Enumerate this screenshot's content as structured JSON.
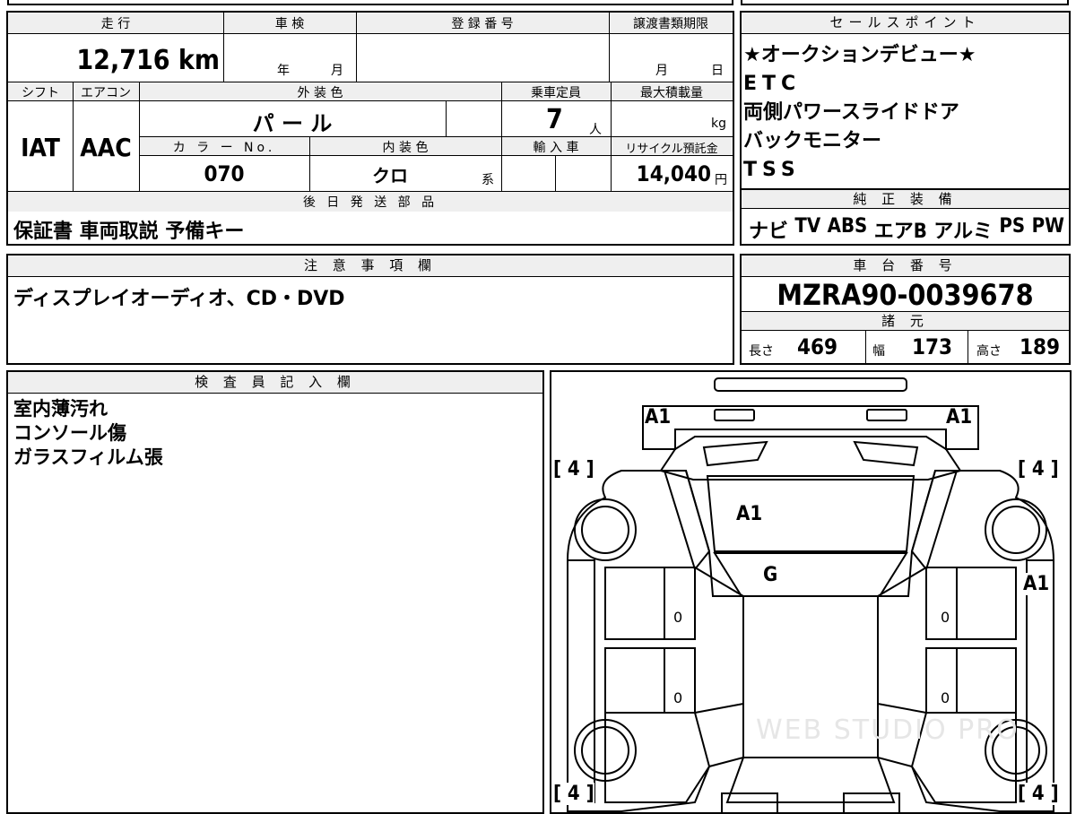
{
  "vehicle": {
    "mileage_label": "走 行",
    "mileage": "12,716 km",
    "inspection_label": "車 検",
    "inspection_year": "年",
    "inspection_month": "月",
    "registration_label": "登 録 番 号",
    "transfer_label": "譲渡書類期限",
    "transfer_month": "月",
    "transfer_day": "日",
    "shift_label": "シフト",
    "shift": "IAT",
    "ac_label": "エアコン",
    "ac": "AAC",
    "exterior_label": "外 装 色",
    "exterior": "パ ー ル",
    "capacity_label": "乗車定員",
    "capacity": "7",
    "capacity_unit": "人",
    "payload_label": "最大積載量",
    "payload_unit": "kg",
    "color_no_label": "カ ラ ー No.",
    "color_no": "070",
    "interior_label": "内 装 色",
    "interior": "クロ",
    "interior_unit": "系",
    "import_label": "輸 入 車",
    "recycle_label": "リサイクル預託金",
    "recycle": "14,040",
    "recycle_unit": "円"
  },
  "later_parts": {
    "label": "後 日 発 送 部 品",
    "items": "保証書 車両取説 予備キー"
  },
  "sales_points": {
    "label": "セールスポイント",
    "items": [
      "★オークションデビュー★",
      "ETC",
      "両側パワースライドドア",
      "バックモニター",
      "TSS"
    ]
  },
  "equipment": {
    "label": "純 正 装 備",
    "items": [
      "ナビ",
      "TV",
      "ABS",
      "エアB",
      "アルミ",
      "PS",
      "PW"
    ]
  },
  "notes": {
    "label": "注 意 事 項 欄",
    "text": "ディスプレイオーディオ、CD・DVD"
  },
  "chassis": {
    "label": "車 台 番 号",
    "number": "MZRA90-0039678"
  },
  "specs": {
    "label": "諸 元",
    "length_label": "長さ",
    "length": "469",
    "width_label": "幅",
    "width": "173",
    "height_label": "高さ",
    "height": "189"
  },
  "inspector": {
    "label": "検 査 員 記 入 欄",
    "lines": [
      "室内薄汚れ",
      "コンソール傷",
      "ガラスフィルム張"
    ]
  },
  "diagram": {
    "marks": {
      "front_left": "A1",
      "front_right": "A1",
      "windshield": "A1",
      "roof_front": "G",
      "right_side": "A1",
      "door_fl": "0",
      "door_rl": "0",
      "door_fr": "0",
      "door_rr": "0"
    },
    "tires": {
      "fl": "[ 4 ]",
      "fr": "[ 4 ]",
      "rl": "[ 4 ]",
      "rr": "[ 4 ]"
    },
    "watermark": "WEB STUDIO PRO"
  }
}
